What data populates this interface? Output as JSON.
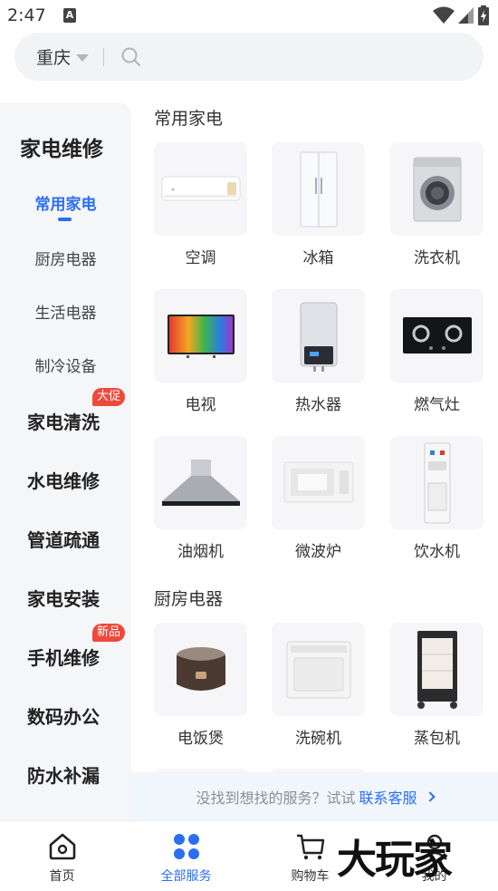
{
  "status": {
    "time": "2:47",
    "a_glyph": "A"
  },
  "search": {
    "city": "重庆"
  },
  "sidebar": {
    "title": "家电维修",
    "subitems": [
      {
        "label": "常用家电",
        "active": true
      },
      {
        "label": "厨房电器",
        "active": false
      },
      {
        "label": "生活电器",
        "active": false
      },
      {
        "label": "制冷设备",
        "active": false
      }
    ],
    "categories": [
      {
        "label": "家电清洗",
        "badge": "大促"
      },
      {
        "label": "水电维修",
        "badge": ""
      },
      {
        "label": "管道疏通",
        "badge": ""
      },
      {
        "label": "家电安装",
        "badge": ""
      },
      {
        "label": "手机维修",
        "badge": "新品"
      },
      {
        "label": "数码办公",
        "badge": ""
      },
      {
        "label": "防水补漏",
        "badge": ""
      }
    ]
  },
  "sections": [
    {
      "title": "常用家电",
      "items": [
        {
          "label": "空调",
          "icon": "air-conditioner-icon"
        },
        {
          "label": "冰箱",
          "icon": "refrigerator-icon"
        },
        {
          "label": "洗衣机",
          "icon": "washing-machine-icon"
        },
        {
          "label": "电视",
          "icon": "television-icon"
        },
        {
          "label": "热水器",
          "icon": "water-heater-icon"
        },
        {
          "label": "燃气灶",
          "icon": "gas-stove-icon"
        },
        {
          "label": "油烟机",
          "icon": "range-hood-icon"
        },
        {
          "label": "微波炉",
          "icon": "microwave-icon"
        },
        {
          "label": "饮水机",
          "icon": "water-dispenser-icon"
        }
      ]
    },
    {
      "title": "厨房电器",
      "items": [
        {
          "label": "电饭煲",
          "icon": "rice-cooker-icon"
        },
        {
          "label": "洗碗机",
          "icon": "dishwasher-icon"
        },
        {
          "label": "蒸包机",
          "icon": "bun-steamer-icon"
        }
      ]
    }
  ],
  "help": {
    "text": "没找到想找的服务？试试",
    "link": "联系客服"
  },
  "nav": [
    {
      "label": "首页",
      "icon": "home-icon",
      "active": false
    },
    {
      "label": "全部服务",
      "icon": "all-services-icon",
      "active": true
    },
    {
      "label": "购物车",
      "icon": "cart-icon",
      "active": false
    },
    {
      "label": "我的",
      "icon": "profile-icon",
      "active": false
    }
  ],
  "watermark": "大玩家",
  "colors": {
    "accent": "#2a6ff0",
    "badge": "#ee4a3b",
    "sidebar_bg": "#f5f6f8",
    "tile_bg": "#f6f6f8"
  }
}
